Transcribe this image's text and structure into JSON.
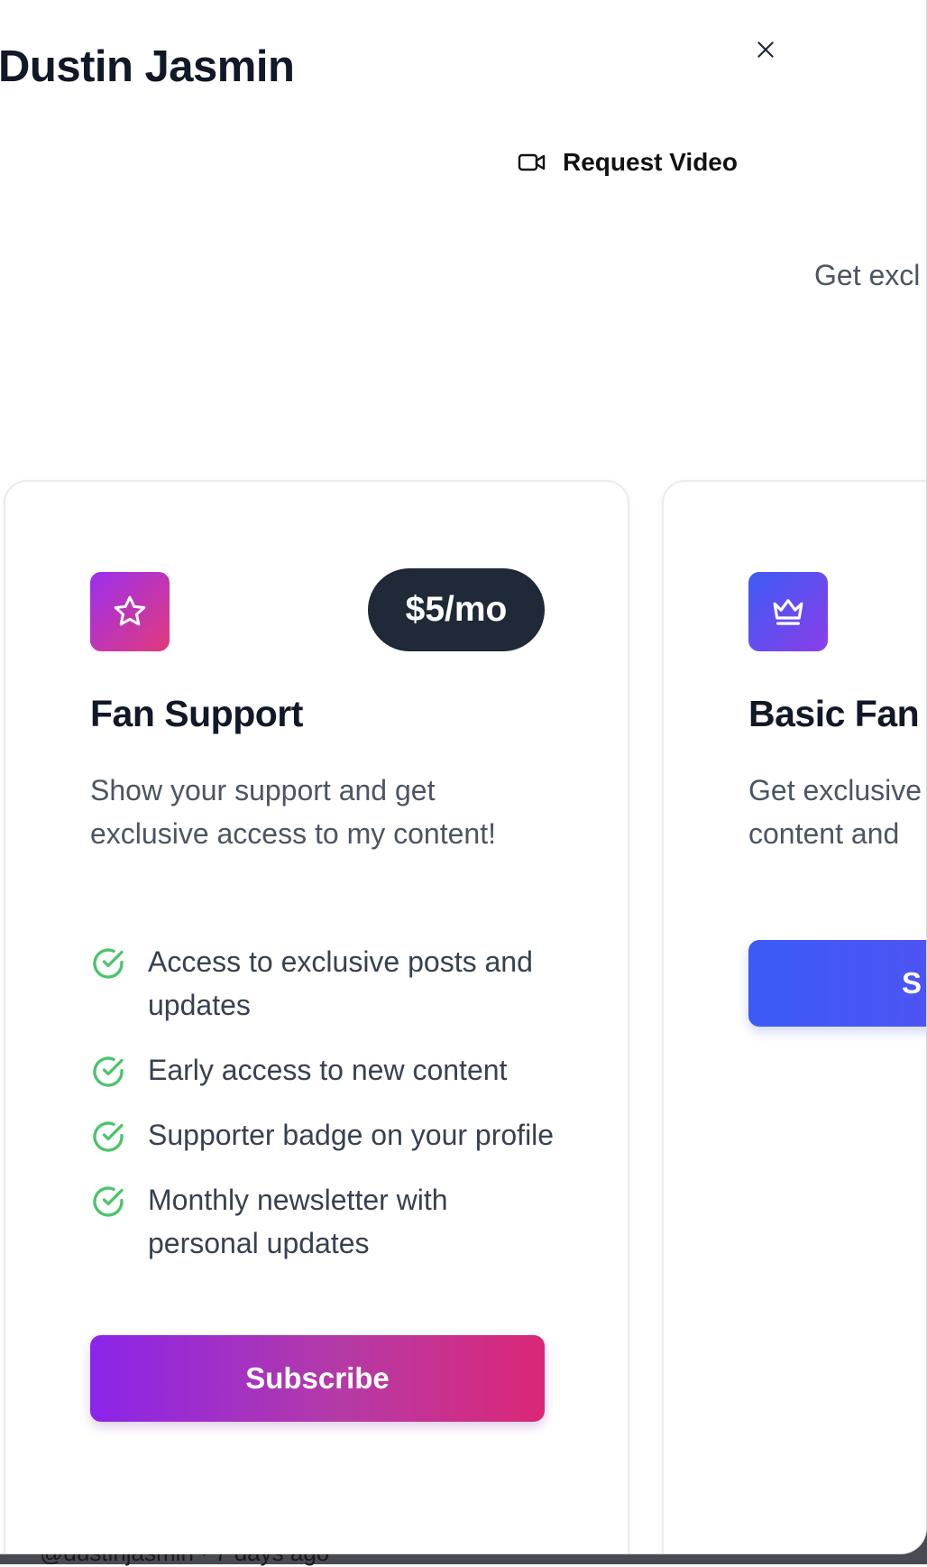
{
  "background": {
    "caption": "@dustinjasmin · 7 days ago"
  },
  "modal": {
    "title": "Dustin Jasmin",
    "close_icon": "close-icon",
    "request_video": {
      "icon": "video-camera-icon",
      "label": "Request Video"
    },
    "intro_text": "Get excl"
  },
  "tiers": [
    {
      "name": "Fan Support",
      "price": "$5/mo",
      "icon": "star-icon",
      "description": "Show your support and get exclusive access to my content!",
      "features": [
        "Access to exclusive posts and updates",
        "Early access to new content",
        "Supporter badge on your profile",
        "Monthly newsletter with personal updates"
      ],
      "button_label": "Subscribe"
    },
    {
      "name": "Basic Fan",
      "icon": "crown-icon",
      "description_line1": "Get exclusive",
      "description_line2": "content and",
      "button_label": "S"
    }
  ],
  "colors": {
    "heading": "#111827",
    "body_text": "#4b5563",
    "price_pill": "#1f2937",
    "check_green": "#4cc46a",
    "pink_gradient": [
      "#8b24ea",
      "#db2777"
    ],
    "blue_gradient": [
      "#3b5bf6",
      "#7c3aed"
    ]
  }
}
